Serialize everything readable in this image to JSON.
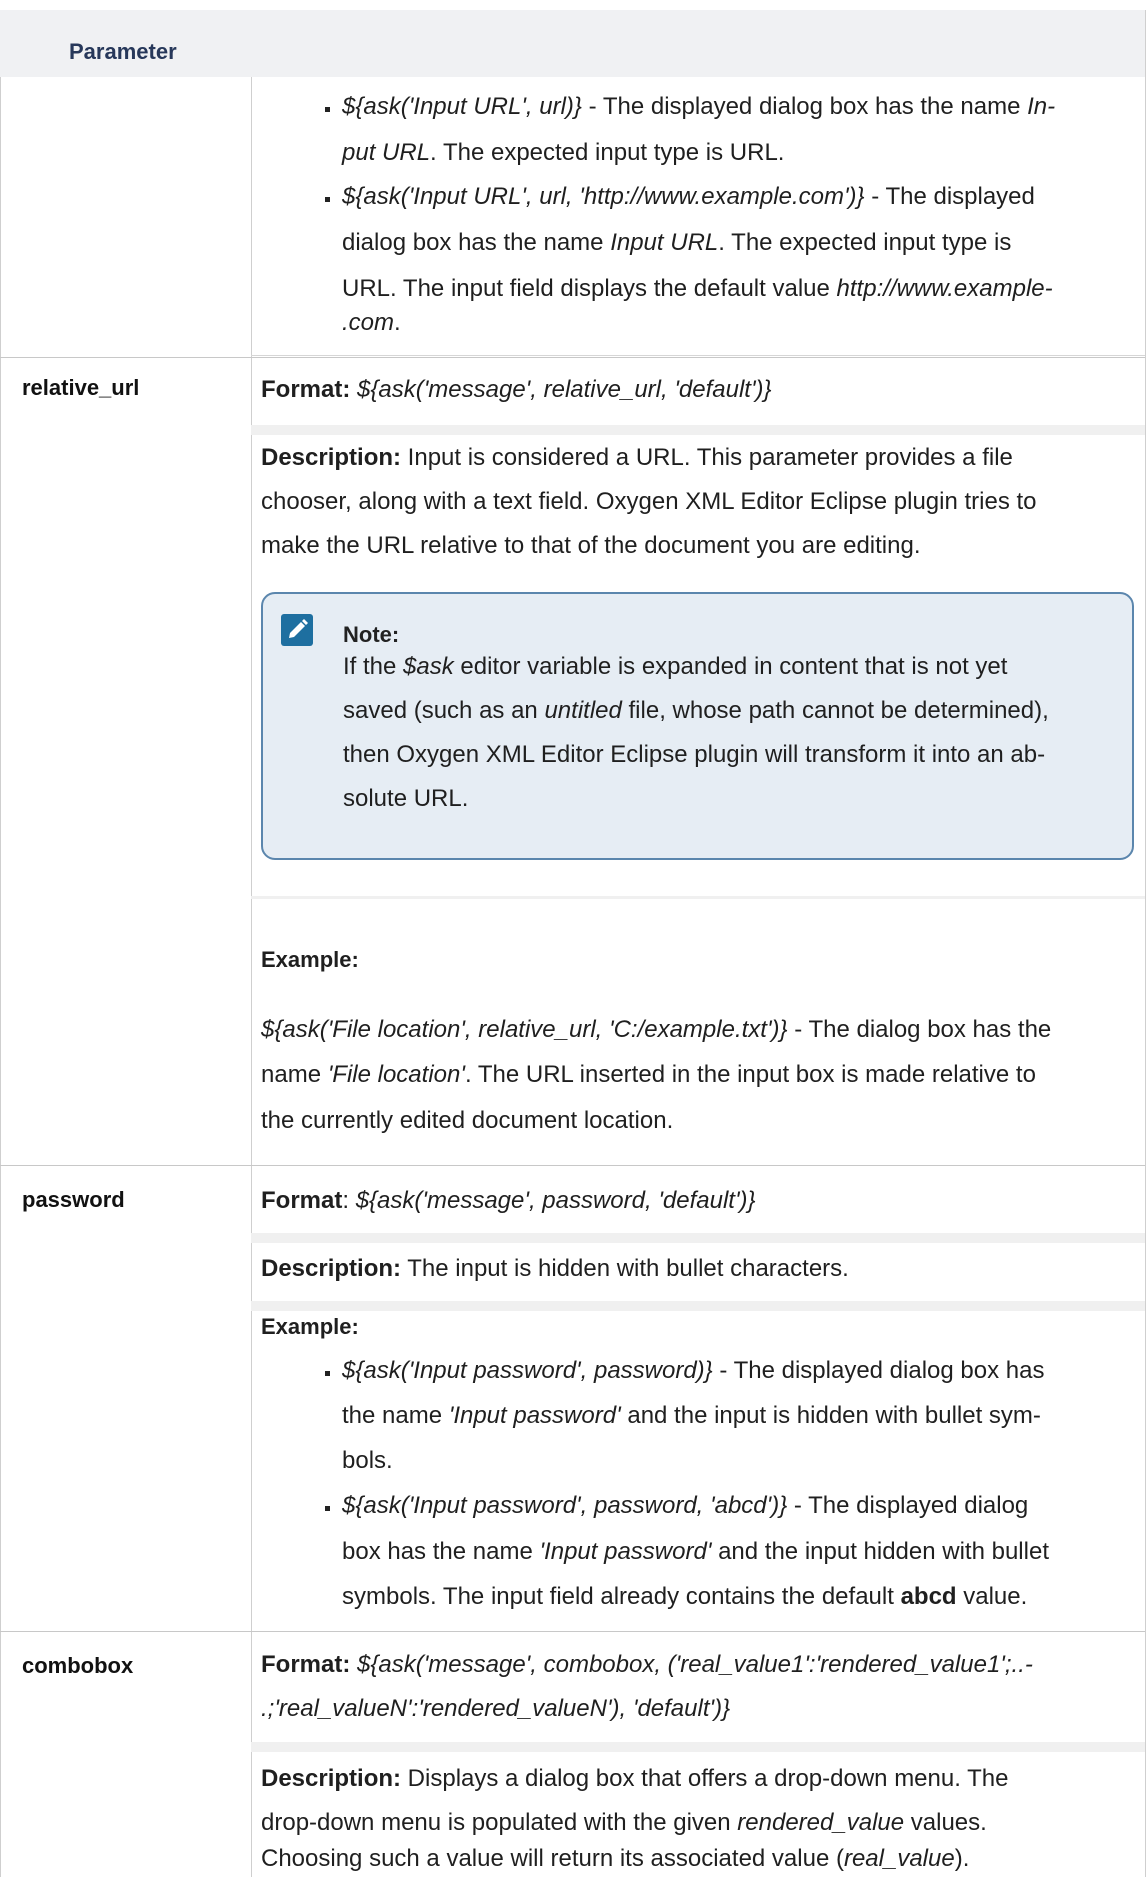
{
  "header": {
    "parameter_label": "Parameter"
  },
  "url_examples": [
    {
      "line1": [
        "${ask('Input URL', url)}",
        " - The displayed dialog box has the name ",
        "In-"
      ],
      "line2": [
        "put URL",
        ". The expected input type is URL."
      ]
    },
    {
      "line1": [
        "${ask('Input URL', url, 'http://www.example.com')}",
        " - The displayed"
      ],
      "line2": "dialog box has the name ",
      "line2_i": "Input URL",
      "line2_b": ". The expected input type is",
      "line3_a": "URL. The input field displays the default value ",
      "line3_i": "http://www.example-",
      "line4": ".com",
      "line4_b": "."
    }
  ],
  "relative_url": {
    "name": "relative_url",
    "format_label": "Format:",
    "format_value": "${ask('message', relative_url, 'default')}",
    "description_label": "Description:",
    "description_lines": [
      " Input is considered a URL. This parameter provides a file",
      "chooser, along with a text field. Oxygen XML Editor Eclipse plugin tries to",
      "make the URL relative to that of the document you are editing."
    ],
    "note": {
      "title": "Note:",
      "l1_a": "If the ",
      "l1_i": "$ask",
      "l1_b": " editor variable is expanded in content that is not yet",
      "l2_a": "saved (such as an ",
      "l2_i": "untitled",
      "l2_b": " file, whose path cannot be determined),",
      "l3": "then Oxygen XML Editor Eclipse plugin will transform it into an ab-",
      "l4": "solute URL."
    },
    "example_label": "Example:",
    "example_i1": "${ask('File location', relative_url, 'C:/example.txt')}",
    "example_t1": " - The dialog box has the",
    "example_t2a": "name ",
    "example_i2": "'File location'",
    "example_t2b": ". The URL inserted in the input box is made relative to",
    "example_t3": "the currently edited document location."
  },
  "password": {
    "name": "password",
    "format_label": "Format",
    "format_colon": ": ",
    "format_value": "${ask('message', password, 'default')}",
    "description_label": "Description:",
    "description": " The input is hidden with bullet characters.",
    "example_label": "Example:",
    "e1_i": "${ask('Input password', password)}",
    "e1_t": " - The displayed dialog box has",
    "e1_l2a": "the name ",
    "e1_l2i": "'Input password'",
    "e1_l2b": " and the input is hidden with bullet sym-",
    "e1_l3": "bols.",
    "e2_i": "${ask('Input password', password, 'abcd')}",
    "e2_t": " - The displayed dialog",
    "e2_l2a": "box has the name ",
    "e2_l2i": "'Input password'",
    "e2_l2b": " and the input hidden with bullet",
    "e2_l3a": "symbols. The input field already contains the default ",
    "e2_l3b": "abcd",
    "e2_l3c": " value."
  },
  "combobox": {
    "name": "combobox",
    "format_label": "Format:",
    "format_l1": "${ask('message', combobox, ('real_value1':'rendered_value1';..-",
    "format_l2": ".;'real_valueN':'rendered_valueN'), 'default')}",
    "description_label": "Description:",
    "d1": " Displays a dialog box that offers a drop-down menu. The",
    "d2a": "drop-down menu is populated with the given ",
    "d2i": "rendered_value",
    "d2b": " values.",
    "d3a": "Choosing such a value will return its associated value (",
    "d3i": "real_value",
    "d3b": ")."
  }
}
